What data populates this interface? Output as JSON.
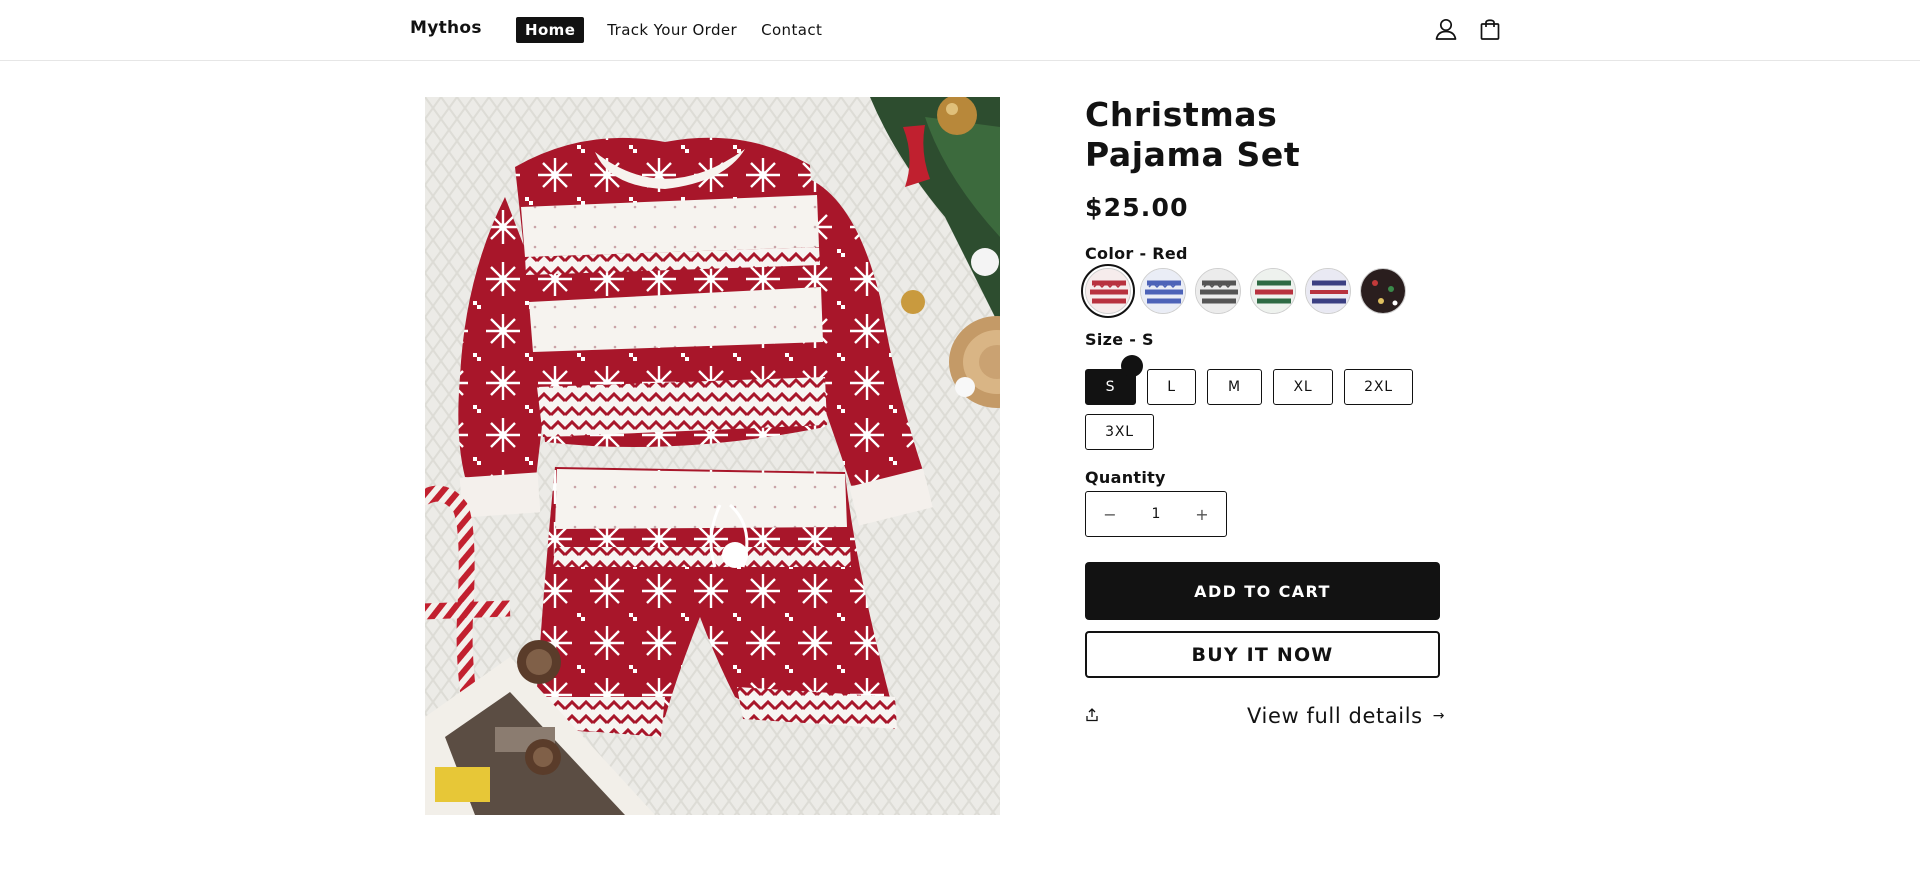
{
  "header": {
    "brand": "Mythos",
    "nav": [
      "Home",
      "Track Your Order",
      "Contact"
    ],
    "icons": [
      "account-icon",
      "cart-icon"
    ]
  },
  "product": {
    "image_alt": "Christmas Pajama Set",
    "title": "Christmas Pajama Set",
    "price": "$25.00",
    "color_label": "Color - Red",
    "color_swatches": [
      {
        "name": "Red",
        "color": "#b8323f",
        "selected": true
      },
      {
        "name": "Blue",
        "color": "#4d63b8",
        "selected": false
      },
      {
        "name": "Grey",
        "color": "#555555",
        "selected": false
      },
      {
        "name": "Green",
        "color": "#2e6a44",
        "selected": false
      },
      {
        "name": "Navy",
        "color": "#3b3f82",
        "selected": false
      },
      {
        "name": "Black",
        "color": "#2a1e1e",
        "selected": false
      }
    ],
    "size_label": "Size - S",
    "sizes": [
      "S",
      "L",
      "M",
      "XL",
      "2XL",
      "3XL"
    ],
    "selected_size": "S",
    "quantity_label": "Quantity",
    "quantity": "1",
    "qty_minus": "−",
    "qty_plus": "+",
    "add_to_cart": "ADD TO CART",
    "buy_now": "BUY IT NOW",
    "view_details": "View full details",
    "view_details_arrow": "→"
  },
  "colors": {
    "primary": "#121212",
    "background": "#ffffff",
    "pattern_red": "#a8162a"
  }
}
